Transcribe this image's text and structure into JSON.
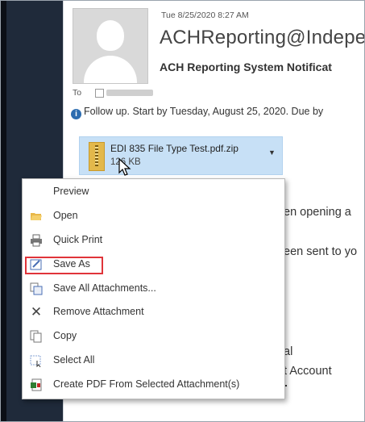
{
  "message": {
    "date": "Tue 8/25/2020 8:27 AM",
    "sender": "ACHReporting@Indepe",
    "subject": "ACH Reporting System Notificat",
    "to_label": "To",
    "followup": "Follow up. Start by Tuesday, August 25, 2020. Due by"
  },
  "attachment": {
    "name": "EDI 835 File Type Test.pdf.zip",
    "size": "126 KB"
  },
  "body_fragments": [
    "en opening a",
    "een sent to yo",
    "al",
    "t Account"
  ],
  "context_menu": {
    "items": [
      {
        "label": "Preview",
        "icon": "none"
      },
      {
        "label": "Open",
        "icon": "folder-open-icon"
      },
      {
        "label": "Quick Print",
        "icon": "printer-icon"
      },
      {
        "label": "Save As",
        "icon": "save-as-icon"
      },
      {
        "label": "Save All Attachments...",
        "icon": "save-all-icon"
      },
      {
        "label": "Remove Attachment",
        "icon": "close-icon"
      },
      {
        "label": "Copy",
        "icon": "copy-icon"
      },
      {
        "label": "Select All",
        "icon": "select-all-icon"
      },
      {
        "label": "Create PDF From Selected Attachment(s)",
        "icon": "pdf-icon"
      }
    ]
  },
  "colors": {
    "highlight": "#e0343a",
    "attachment_bg": "#c7e0f6",
    "sidebar": "#1f2a3a"
  }
}
